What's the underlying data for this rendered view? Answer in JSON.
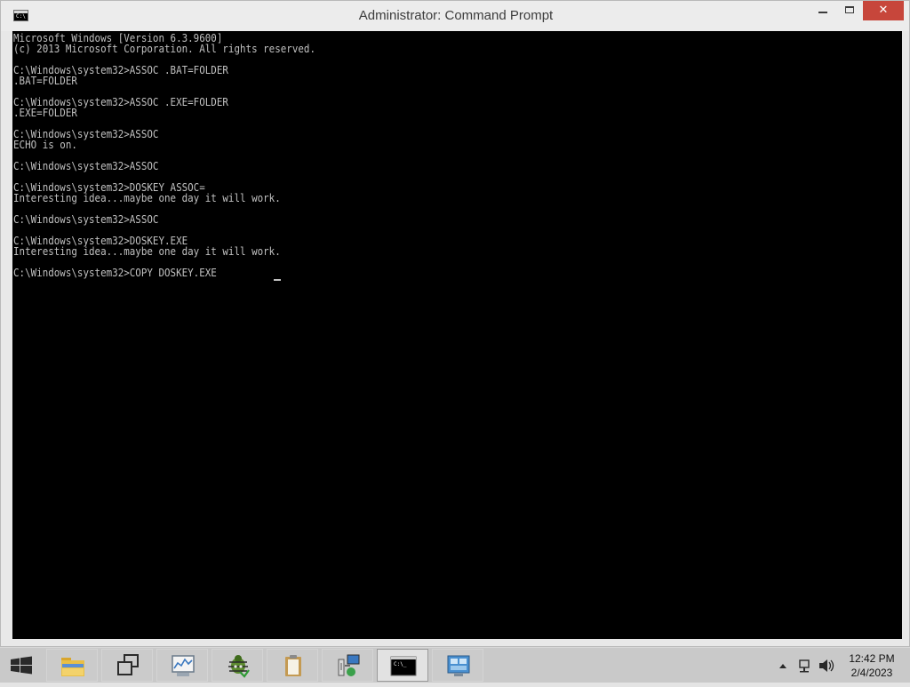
{
  "window": {
    "title": "Administrator:  Command Prompt",
    "icon_text": "C:\\"
  },
  "console": {
    "lines": [
      "Microsoft Windows [Version 6.3.9600]",
      "(c) 2013 Microsoft Corporation. All rights reserved.",
      "",
      "C:\\Windows\\system32>ASSOC .BAT=FOLDER",
      ".BAT=FOLDER",
      "",
      "C:\\Windows\\system32>ASSOC .EXE=FOLDER",
      ".EXE=FOLDER",
      "",
      "C:\\Windows\\system32>ASSOC",
      "ECHO is on.",
      "",
      "C:\\Windows\\system32>ASSOC",
      "",
      "C:\\Windows\\system32>DOSKEY ASSOC=",
      "Interesting idea...maybe one day it will work.",
      "",
      "C:\\Windows\\system32>ASSOC",
      "",
      "C:\\Windows\\system32>DOSKEY.EXE",
      "Interesting idea...maybe one day it will work.",
      "",
      "C:\\Windows\\system32>COPY DOSKEY.EXE"
    ]
  },
  "taskbar": {
    "start_icon": "windows-logo-icon",
    "buttons": [
      {
        "name": "file-explorer",
        "icon": "folder-icon",
        "active": false
      },
      {
        "name": "task-view",
        "icon": "window-switcher-icon",
        "active": false
      },
      {
        "name": "system-monitor",
        "icon": "monitor-chart-icon",
        "active": false
      },
      {
        "name": "bug-tool",
        "icon": "bug-icon",
        "active": false
      },
      {
        "name": "clipboard",
        "icon": "clipboard-icon",
        "active": false
      },
      {
        "name": "network-setup",
        "icon": "network-computer-icon",
        "active": false
      },
      {
        "name": "command-prompt",
        "icon": "command-prompt-icon",
        "active": true
      },
      {
        "name": "control-panel",
        "icon": "control-panel-icon",
        "active": false
      }
    ],
    "tray_icons": [
      "chevron-up-icon",
      "network-icon",
      "speaker-icon"
    ],
    "clock": {
      "time": "12:42 PM",
      "date": "2/4/2023"
    }
  },
  "colors": {
    "console_bg": "#000000",
    "console_fg": "#c0c0c0",
    "close_button": "#c7463b",
    "taskbar_bg": "#c9c9c9"
  }
}
